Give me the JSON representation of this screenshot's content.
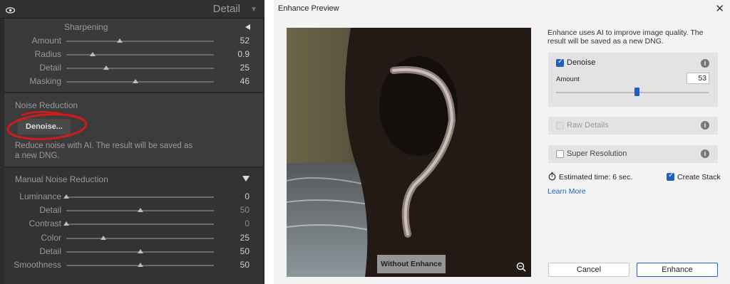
{
  "left_panel": {
    "header_title": "Detail",
    "sharpening": {
      "title": "Sharpening",
      "sliders": [
        {
          "label": "Amount",
          "value": "52",
          "level": 0.36
        },
        {
          "label": "Radius",
          "value": "0.9",
          "level": 0.18
        },
        {
          "label": "Detail",
          "value": "25",
          "level": 0.27
        },
        {
          "label": "Masking",
          "value": "46",
          "level": 0.47
        }
      ]
    },
    "noise_reduction": {
      "title": "Noise Reduction",
      "denoise_button": "Denoise...",
      "description": "Reduce noise with AI. The result will be saved as a new DNG."
    },
    "manual_noise_reduction": {
      "title": "Manual Noise Reduction",
      "sliders": [
        {
          "label": "Luminance",
          "value": "0",
          "level": 0.0,
          "dim": false
        },
        {
          "label": "Detail",
          "value": "50",
          "level": 0.5,
          "dim": true
        },
        {
          "label": "Contrast",
          "value": "0",
          "level": 0.0,
          "dim": true
        },
        {
          "label": "Color",
          "value": "25",
          "level": 0.25,
          "dim": false
        },
        {
          "label": "Detail",
          "value": "50",
          "level": 0.5,
          "dim": false
        },
        {
          "label": "Smoothness",
          "value": "50",
          "level": 0.5,
          "dim": false
        }
      ]
    }
  },
  "dialog": {
    "title": "Enhance Preview",
    "intro": "Enhance uses AI to improve image quality. The result will be saved as a new DNG.",
    "denoise": {
      "label": "Denoise",
      "amount_label": "Amount",
      "amount_value": "53",
      "level": 0.53,
      "checked": true
    },
    "raw_details": {
      "label": "Raw Details",
      "checked": false,
      "disabled": true
    },
    "super_resolution": {
      "label": "Super Resolution",
      "checked": false
    },
    "estimated_time": "Estimated time: 6 sec.",
    "create_stack": {
      "label": "Create Stack",
      "checked": true
    },
    "learn_more": "Learn More",
    "without_enhance": "Without Enhance",
    "cancel": "Cancel",
    "enhance": "Enhance"
  }
}
